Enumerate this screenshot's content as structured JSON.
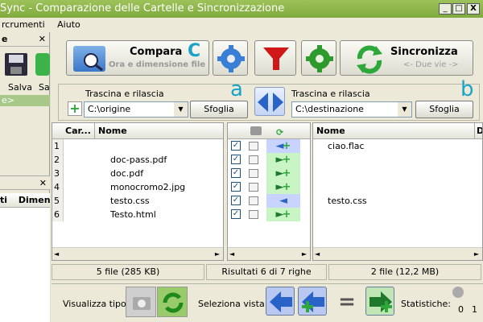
{
  "window": {
    "title": "Sync - Comparazione delle Cartelle e Sincronizzazione",
    "min": "_",
    "max": "□",
    "close": "X"
  },
  "menu": {
    "item1": "rcrumenti",
    "item2": "Aiuto"
  },
  "left_panel": {
    "header": "e",
    "close": "✕",
    "save_label": "Salva",
    "sa_label": "Sa",
    "selected_item": "e>",
    "header2_close": "✕",
    "col1": "ti",
    "col2": "Dimen"
  },
  "toolbar": {
    "compare_title": "Compara",
    "compare_subtitle": "Ora e dimensione file",
    "compare_letter": "C",
    "sync_title": "Sincronizza",
    "sync_subtitle": "<- Due vie ->"
  },
  "left_folder": {
    "label": "Trascina e rilascia",
    "path": "C:\\origine",
    "browse": "Sfoglia",
    "letter": "a"
  },
  "right_folder": {
    "label": "Trascina e rilascia",
    "path": "C:\\destinazione",
    "browse": "Sfoglia",
    "letter": "b"
  },
  "left_grid": {
    "col_car": "Car...",
    "col_name": "Nome",
    "rows": [
      {
        "n": "1",
        "name": ""
      },
      {
        "n": "2",
        "name": "doc-pass.pdf"
      },
      {
        "n": "3",
        "name": "doc.pdf"
      },
      {
        "n": "4",
        "name": "monocromo2.jpg"
      },
      {
        "n": "5",
        "name": "testo.css"
      },
      {
        "n": "6",
        "name": "Testo.html"
      }
    ]
  },
  "right_grid": {
    "col_name": "Nome",
    "col_d": "D",
    "rows": [
      {
        "name": "ciao.flac"
      },
      {
        "name": ""
      },
      {
        "name": ""
      },
      {
        "name": ""
      },
      {
        "name": "testo.css"
      },
      {
        "name": ""
      }
    ]
  },
  "middle_actions": [
    "copy-left-create",
    "copy-right-create",
    "copy-right-create",
    "copy-right-create",
    "copy-left",
    "copy-right-create"
  ],
  "status": {
    "left": "5 file (285 KB)",
    "middle": "Risultati 6 di 7 righe",
    "right": "2 file (12,2 MB)"
  },
  "bottom": {
    "view_type_label": "Visualizza tipo:",
    "select_view_label": "Seleziona vista:",
    "equal_sign": "=",
    "stats_label": "Statistiche:",
    "stats_a": "0",
    "stats_b": "1"
  },
  "colors": {
    "title_green": "#7faa3c",
    "row_blue": "#c8d4ff",
    "row_green": "#c9f5c4",
    "accent_letter": "#1aa3c9"
  }
}
